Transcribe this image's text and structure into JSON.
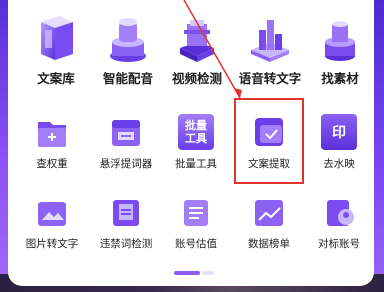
{
  "row1": [
    {
      "label": "文案库",
      "icon": "document-library-icon"
    },
    {
      "label": "智能配音",
      "icon": "voice-icon"
    },
    {
      "label": "视频检测",
      "icon": "video-detect-icon"
    },
    {
      "label": "语音转文字",
      "icon": "speech-to-text-icon"
    },
    {
      "label": "找素材",
      "icon": "material-icon"
    }
  ],
  "row2": [
    {
      "label": "查权重",
      "icon": "weight-icon"
    },
    {
      "label": "悬浮提词器",
      "icon": "teleprompter-icon"
    },
    {
      "label": "批量工具",
      "icon": "batch-tool-icon",
      "icon_text_1": "批量",
      "icon_text_2": "工具"
    },
    {
      "label": "文案提取",
      "icon": "text-extract-icon"
    },
    {
      "label": "去水映",
      "icon": "watermark-icon",
      "icon_text": "印"
    }
  ],
  "row3": [
    {
      "label": "图片转文字",
      "icon": "image-to-text-icon"
    },
    {
      "label": "违禁词检测",
      "icon": "banned-word-icon"
    },
    {
      "label": "账号估值",
      "icon": "account-value-icon"
    },
    {
      "label": "数据榜单",
      "icon": "data-ranking-icon"
    },
    {
      "label": "对标账号",
      "icon": "benchmark-account-icon"
    }
  ],
  "colors": {
    "accent": "#8a5cf5",
    "highlight": "#e2332b"
  },
  "pager": {
    "active": 1,
    "pages": 2
  }
}
